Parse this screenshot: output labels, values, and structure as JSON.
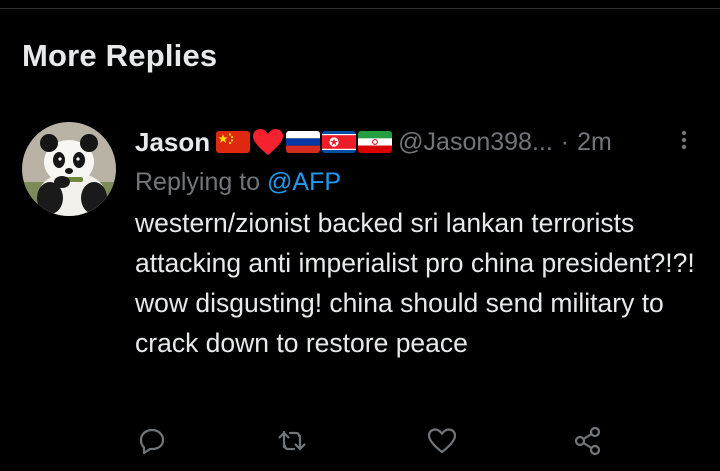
{
  "section": {
    "title": "More Replies"
  },
  "tweet": {
    "display_name": "Jason",
    "flags": [
      "flag-china",
      "heart-red",
      "flag-russia",
      "flag-north-korea",
      "flag-iran"
    ],
    "handle": "@Jason398...",
    "separator": "·",
    "time": "2m",
    "replying_prefix": "Replying to ",
    "replying_to": "@AFP",
    "text": "western/zionist backed sri lankan terrorists attacking anti imperialist pro china president?!?! wow disgusting! china should send military to crack down to restore peace"
  },
  "actions": [
    "reply-icon",
    "retweet-icon",
    "like-icon",
    "share-icon"
  ],
  "colors": {
    "background": "#000000",
    "text": "#e7e9ea",
    "muted": "#71767b",
    "accent": "#1d9bf0"
  }
}
